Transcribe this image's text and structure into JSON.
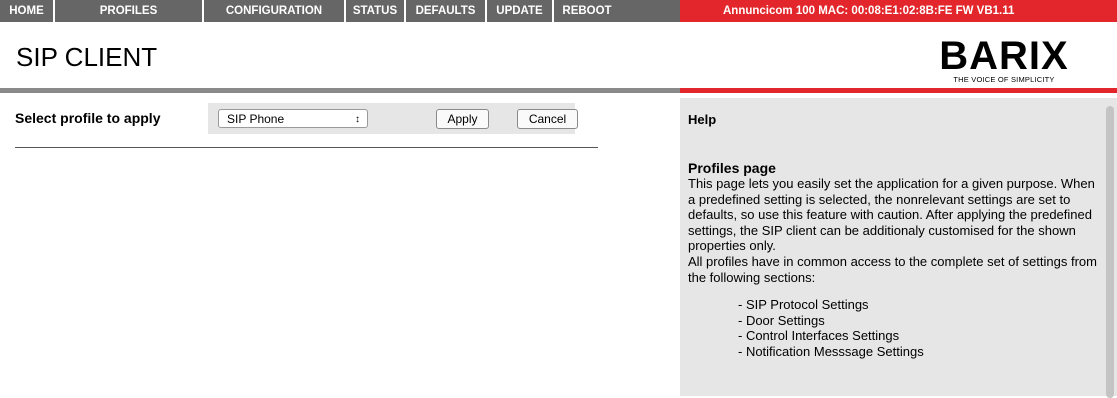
{
  "nav": {
    "items": [
      "HOME",
      "PROFILES",
      "CONFIGURATION",
      "STATUS",
      "DEFAULTS",
      "UPDATE",
      "REBOOT"
    ],
    "device_info": "Annuncicom 100   MAC: 00:08:E1:02:8B:FE  FW VB1.11"
  },
  "header": {
    "title": "SIP CLIENT",
    "logo_text": "BARIX",
    "logo_tagline": "THE VOICE OF SIMPLICITY"
  },
  "form": {
    "label": "Select profile to apply",
    "selected_profile": "SIP Phone",
    "select_arrows": "↕",
    "apply_label": "Apply",
    "cancel_label": "Cancel"
  },
  "help": {
    "title": "Help",
    "subtitle": "Profiles page",
    "paragraph1": "This page lets you easily set the application for a given purpose. When a predefined setting is selected, the nonrelevant settings are set to defaults, so use this feature with caution. After applying the predefined settings, the SIP client can be additionaly customised for the shown properties only.",
    "paragraph2": "All profiles have in common access to the complete set of settings from the following sections:",
    "list": [
      "- SIP Protocol Settings",
      "- Door Settings",
      "- Control Interfaces Settings",
      "- Notification Messsage Settings"
    ]
  },
  "colors": {
    "nav_gray": "#666666",
    "accent_red": "#e3262b",
    "panel_gray": "#e6e6e6"
  }
}
